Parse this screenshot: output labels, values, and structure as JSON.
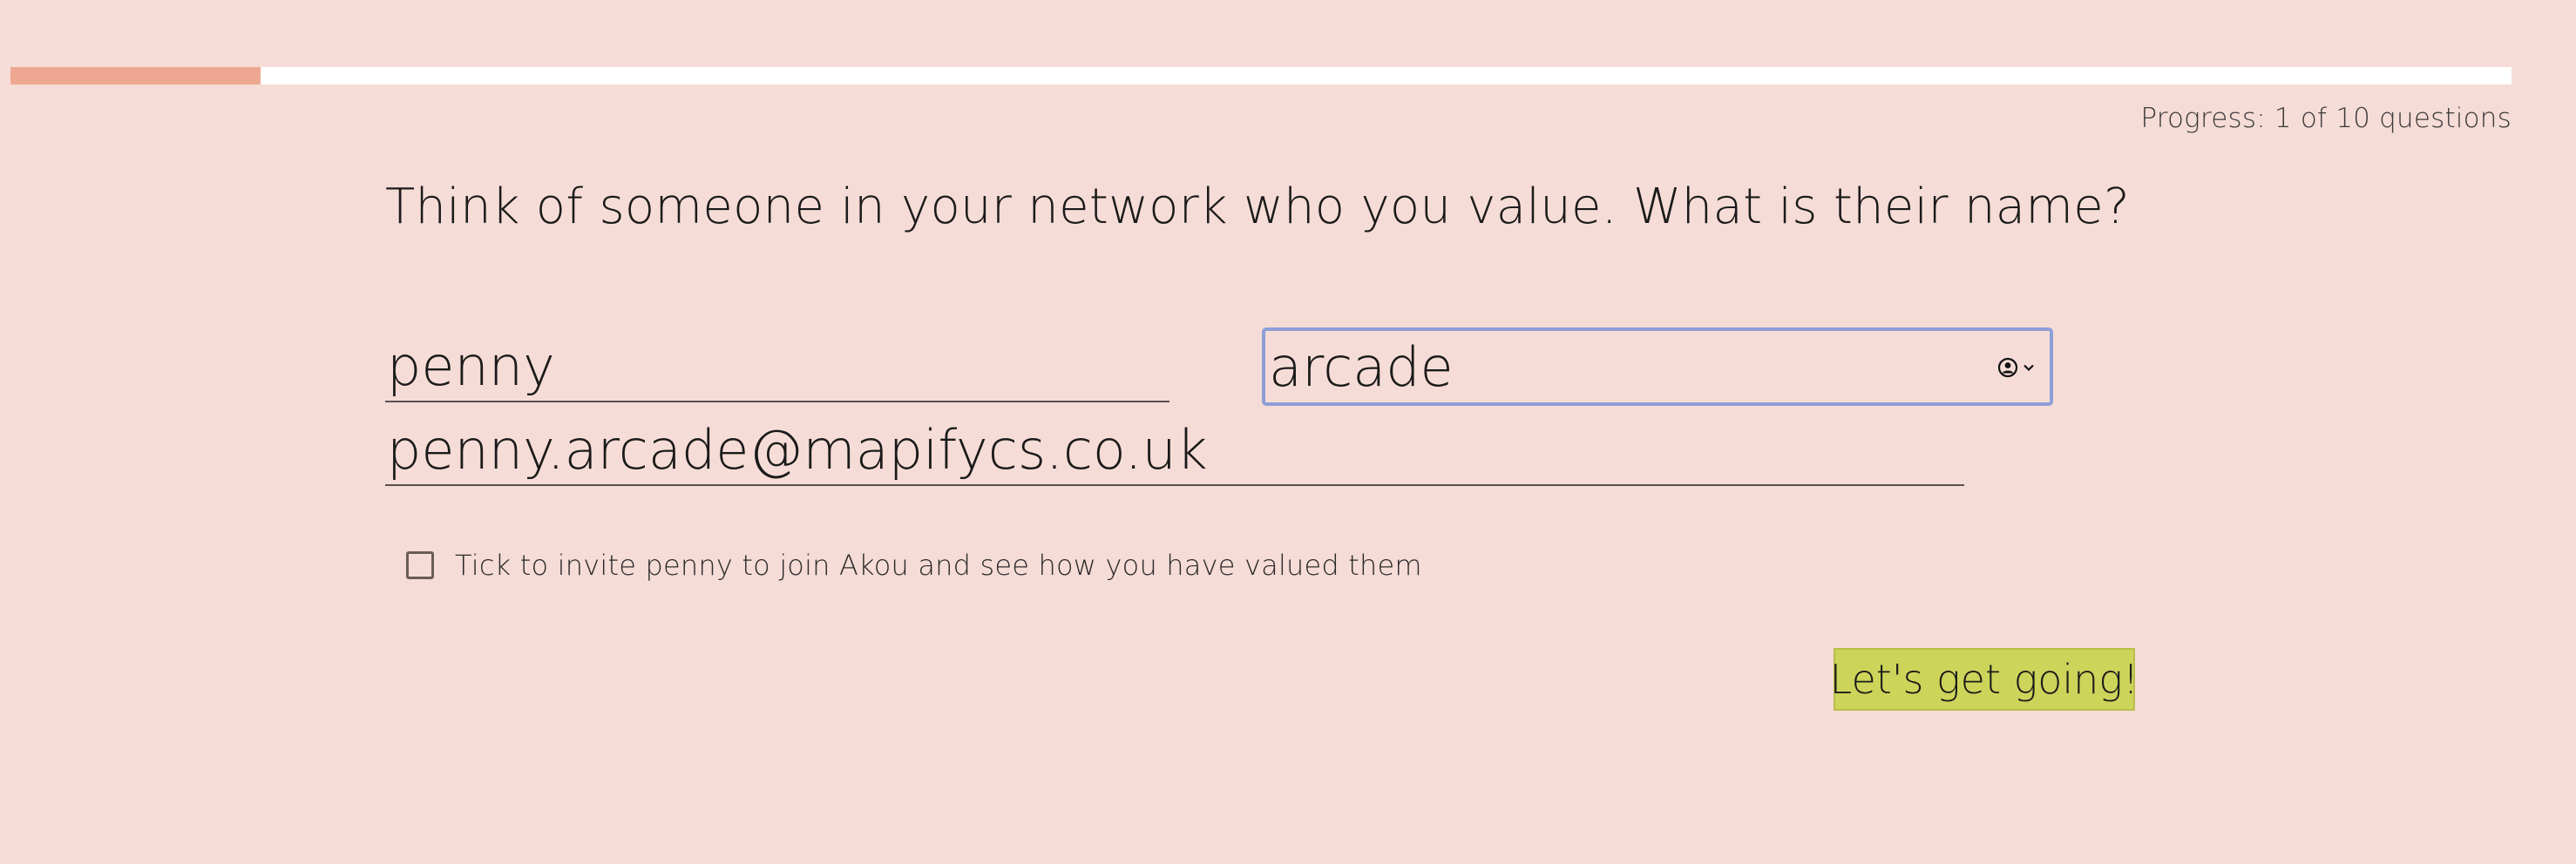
{
  "progress": {
    "fraction": 0.1,
    "text": "Progress: 1 of 10 questions",
    "fill_color": "#eea892",
    "track_color": "#ffffff"
  },
  "question": {
    "text": "Think of someone in your network who you value. What is their name?"
  },
  "form": {
    "first_name_value": "penny",
    "last_name_value": "arcade",
    "email_value": "penny.arcade@mapifycs.co.uk",
    "autofill_icon": "contact-autofill-icon",
    "checkbox_checked": false,
    "checkbox_label": "Tick to invite penny to join Akou and see how you have valued them"
  },
  "actions": {
    "go_label": "Let's get going!",
    "go_color": "#cdd45a"
  },
  "colors": {
    "background": "#f6dcd6",
    "focus_ring": "#8e9fd8"
  }
}
